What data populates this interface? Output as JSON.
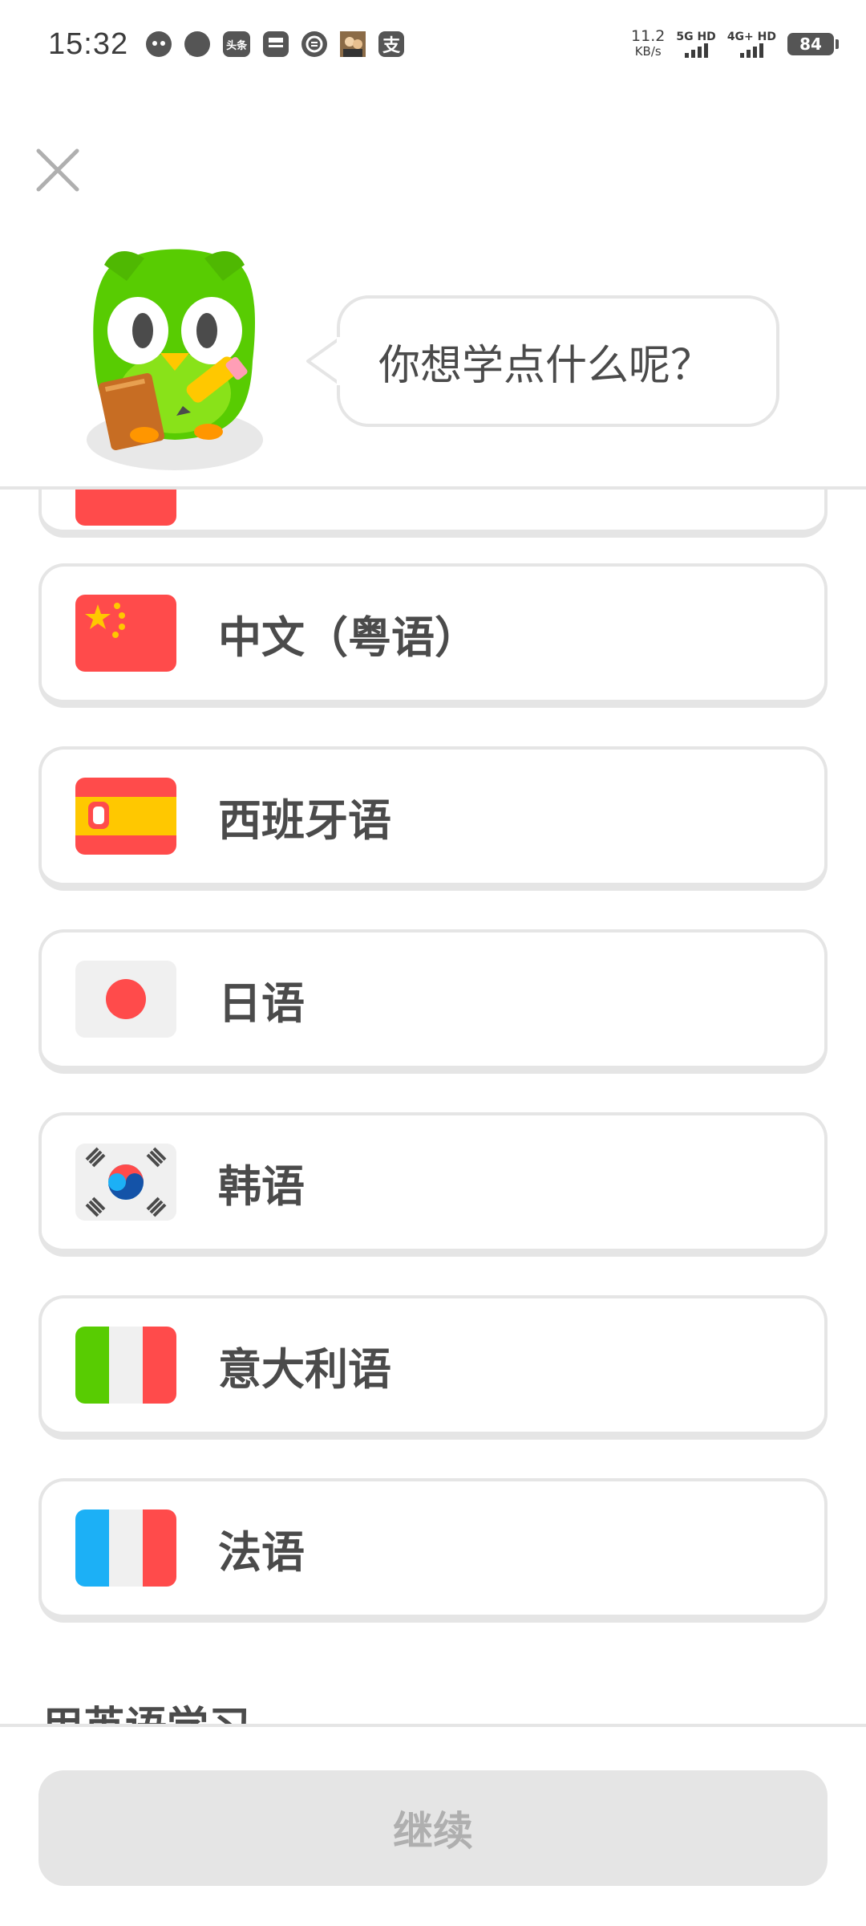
{
  "status_bar": {
    "time": "15:32",
    "net_speed_value": "11.2",
    "net_speed_unit": "KB/s",
    "signal1_label": "5G HD",
    "signal2_label": "4G+ HD",
    "battery": "84",
    "app_icons": [
      "owl-app-icon",
      "chat-bubble-icon",
      "toutiao-icon",
      "bus-card-icon",
      "unionpay-icon",
      "game-avatar-icon",
      "alipay-icon"
    ],
    "toutiao_text": "头条",
    "alipay_text": "支"
  },
  "header": {
    "prompt": "你想学点什么呢？"
  },
  "languages": [
    {
      "label": "中文（粤语）",
      "flag": "china-flag"
    },
    {
      "label": "西班牙语",
      "flag": "spain-flag"
    },
    {
      "label": "日语",
      "flag": "japan-flag"
    },
    {
      "label": "韩语",
      "flag": "korea-flag"
    },
    {
      "label": "意大利语",
      "flag": "italy-flag"
    },
    {
      "label": "法语",
      "flag": "france-flag"
    }
  ],
  "section_heading": "用英语学习",
  "footer": {
    "continue_label": "继续"
  },
  "colors": {
    "owl_green": "#58cc02",
    "card_border": "#e5e5e5",
    "disabled_button": "#e5e5e5",
    "disabled_text": "#afafaf",
    "text": "#4b4b4b"
  }
}
